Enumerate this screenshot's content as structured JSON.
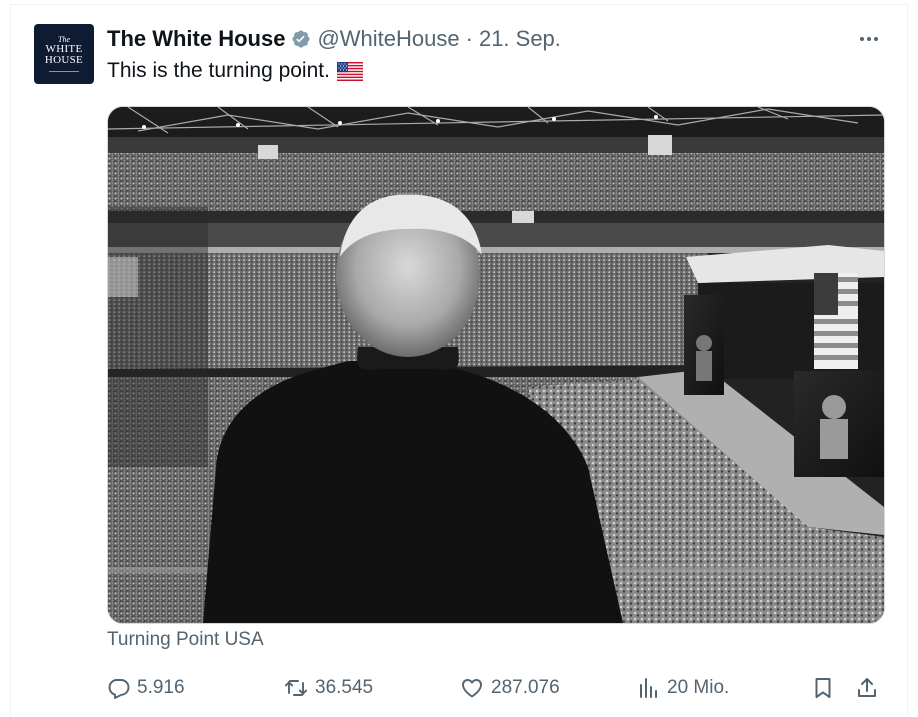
{
  "tweet": {
    "author_name": "The White House",
    "handle": "@WhiteHouse",
    "separator": "·",
    "date": "21. Sep.",
    "text": "This is the turning point.",
    "media_caption": "Turning Point USA",
    "avatar": {
      "line1": "The",
      "line2": "WHITE",
      "line3": "HOUSE"
    },
    "verified_badge_color": "#829aab",
    "icons": {
      "verified": "verified-badge-icon",
      "flag": "us-flag-emoji-icon",
      "more": "more-options-icon"
    }
  },
  "actions": {
    "replies": "5.916",
    "reposts": "36.545",
    "likes": "287.076",
    "views": "20 Mio."
  },
  "colors": {
    "primary_text": "#0f1419",
    "secondary_text": "#536471",
    "border": "#cfd9de",
    "avatar_bg": "#0e1b33"
  }
}
